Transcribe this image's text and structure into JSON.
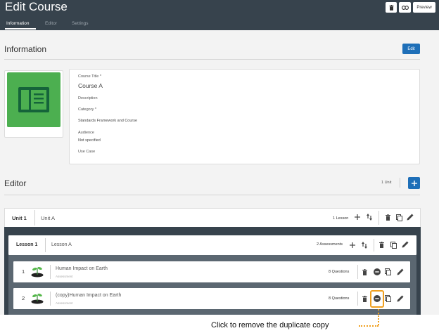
{
  "header": {
    "title": "Edit Course",
    "preview_label": "Preview",
    "tabs": [
      {
        "label": "Information",
        "active": true
      },
      {
        "label": "Editor",
        "active": false
      },
      {
        "label": "Settings",
        "active": false
      }
    ]
  },
  "information": {
    "title": "Information",
    "edit_label": "Edit",
    "fields": {
      "course_title_label": "Course Title *",
      "course_title_value": "Course A",
      "description_label": "Description",
      "category_label": "Category *",
      "category_value": "Standards Framework and Course",
      "audience_label": "Audience",
      "audience_value": "Not specified",
      "use_case_label": "Use Case"
    }
  },
  "editor": {
    "title": "Editor",
    "unit_count": "1 Unit",
    "unit": {
      "number": "Unit 1",
      "name": "Unit A",
      "lesson_count": "1 Lesson",
      "lesson": {
        "number": "Lesson 1",
        "name": "Lesson A",
        "assessment_count": "2 Assessments",
        "assessments": [
          {
            "index": "1",
            "title": "Human Impact on Earth",
            "type": "Assessment",
            "questions": "8 Questions"
          },
          {
            "index": "2",
            "title": "(copy)Human Impact on Earth",
            "type": "Assessment",
            "questions": "8 Questions"
          }
        ]
      }
    }
  },
  "callout": "Click to remove the duplicate copy",
  "colors": {
    "header_bg": "#37434d",
    "accent_blue": "#1e6fb8",
    "thumb_green": "#4caf50",
    "highlight_orange": "#f0a020"
  }
}
